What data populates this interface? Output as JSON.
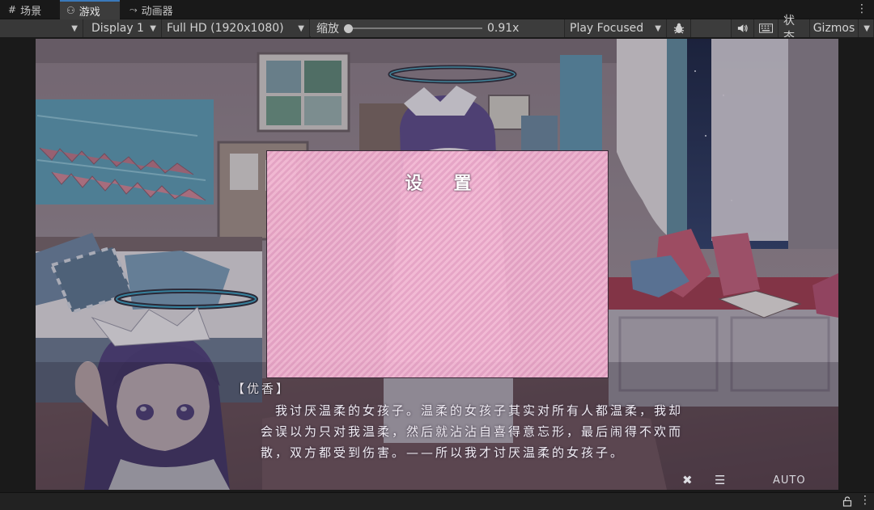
{
  "tabs": [
    {
      "icon": "#",
      "label": "场景"
    },
    {
      "icon": "⚇",
      "label": "游戏"
    },
    {
      "icon": "⤳",
      "label": "动画器"
    }
  ],
  "toolbar": {
    "display": "Display 1",
    "resolution": "Full HD (1920x1080)",
    "scale_label": "缩放",
    "scale_value": "0.91x",
    "scale_fraction": 0.0,
    "play_mode": "Play Focused",
    "stats": "状态",
    "gizmos": "Gizmos"
  },
  "game": {
    "speaker": "【优香】",
    "dialogue": [
      "我讨厌温柔的女孩子。温柔的女孩子其实对所有人都温柔，我却",
      "会误以为只对我温柔，然后就沾沾自喜得意忘形，最后闹得不欢而",
      "散，双方都受到伤害。——所以我才讨厌温柔的女孩子。"
    ],
    "settings_title": "设置",
    "auto_label": "AUTO"
  },
  "colors": {
    "editor_bg": "#191919",
    "toolbar_bg": "#3c3c3c",
    "accent_tab": "#3a79bb",
    "panel_pink": "#f6bad6",
    "room_wall": "#9d8f95"
  }
}
